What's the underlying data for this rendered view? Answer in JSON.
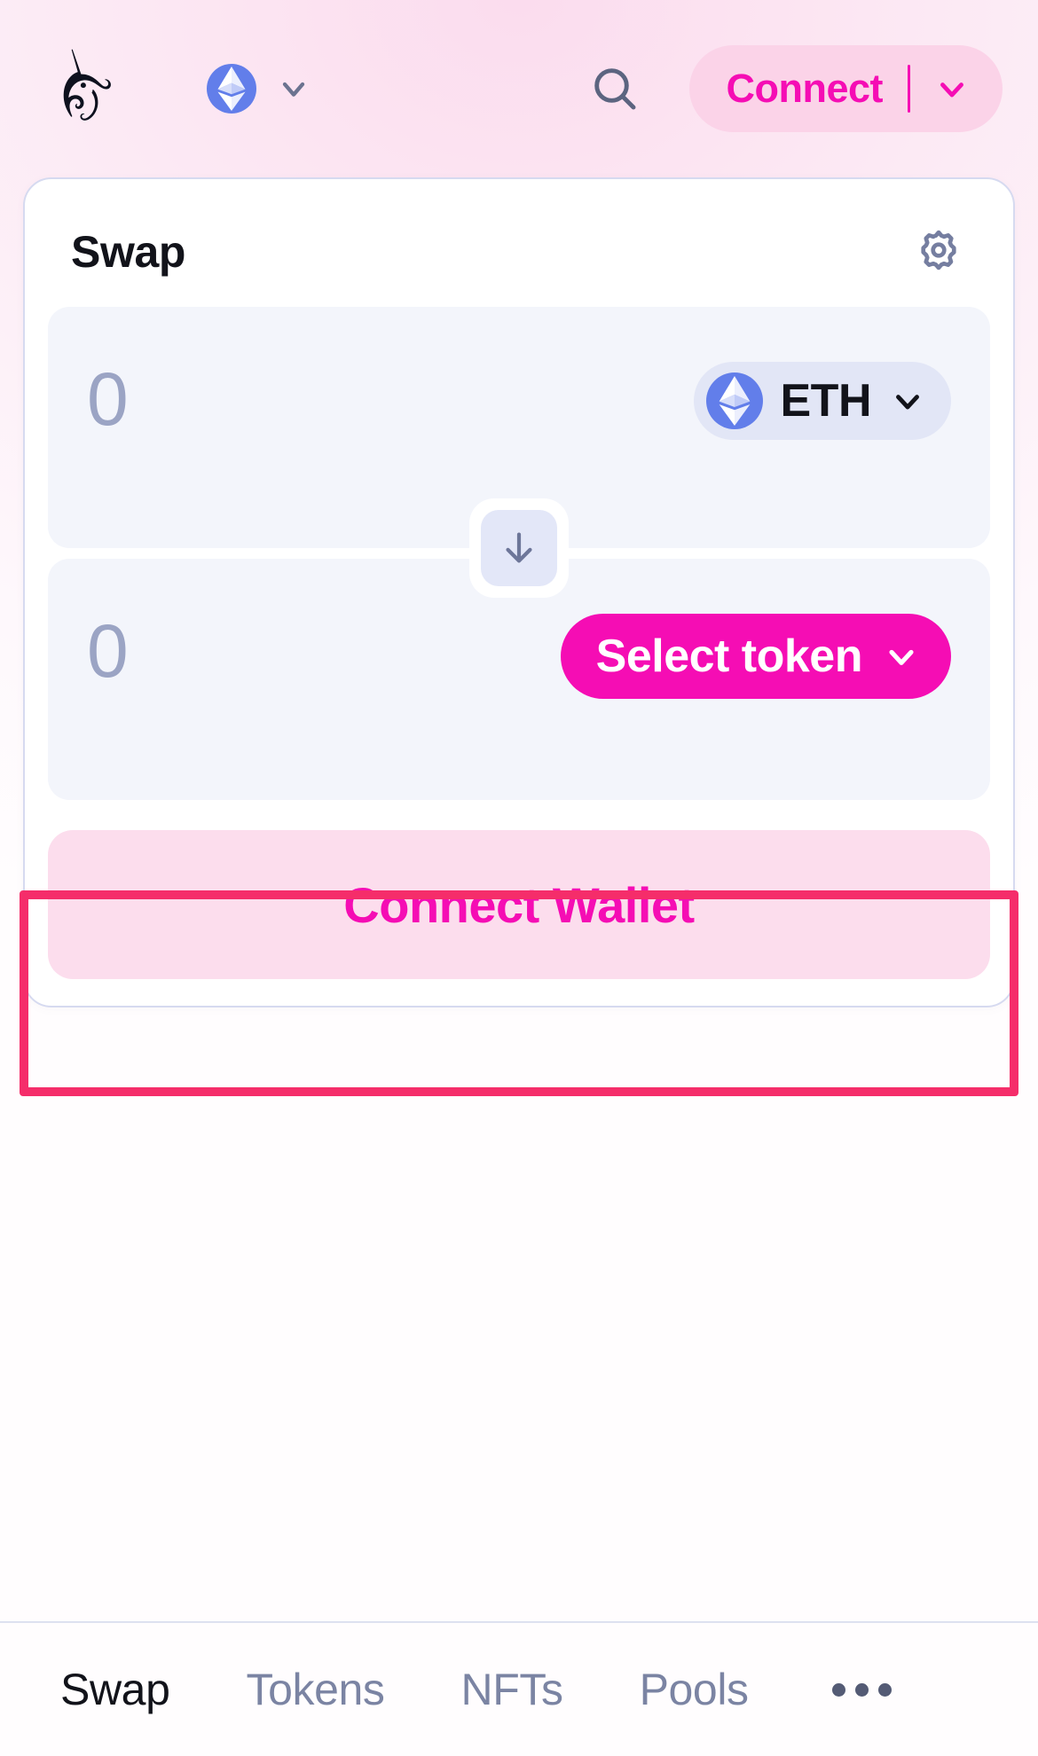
{
  "app": {
    "title": "Uniswap",
    "background_color": "#FDF0F8",
    "brand_pink": "#F50DB4",
    "annotation_color": "#F52D6A"
  },
  "header": {
    "logo_icon": "uniswap-unicorn-logo",
    "network": {
      "name": "Ethereum",
      "icon": "ethereum-icon",
      "icon_color": "#627EEA",
      "chevron_icon": "chevron-down-icon"
    },
    "search_icon": "search-icon",
    "connect": {
      "label": "Connect",
      "chevron_icon": "chevron-down-icon",
      "text_color": "#F50DB4",
      "background_color": "#FBD3E8"
    }
  },
  "swap_card": {
    "title": "Swap",
    "settings_icon": "gear-icon",
    "input_field": {
      "amount": "0",
      "placeholder": "0",
      "token": {
        "symbol": "ETH",
        "icon": "ethereum-icon",
        "chevron_icon": "chevron-down-icon"
      }
    },
    "switch_button": {
      "icon": "arrow-down-icon",
      "label": "Switch tokens"
    },
    "output_field": {
      "amount": "0",
      "placeholder": "0",
      "token": {
        "label": "Select token",
        "chevron_icon": "chevron-down-icon",
        "background_color": "#F50DB4"
      }
    },
    "cta": {
      "label": "Connect Wallet",
      "text_color": "#F50DB4",
      "background_color": "#FCDDED"
    }
  },
  "bottom_nav": {
    "items": [
      {
        "label": "Swap",
        "active": true
      },
      {
        "label": "Tokens",
        "active": false
      },
      {
        "label": "NFTs",
        "active": false
      },
      {
        "label": "Pools",
        "active": false
      }
    ],
    "more_icon": "ellipsis-icon"
  }
}
